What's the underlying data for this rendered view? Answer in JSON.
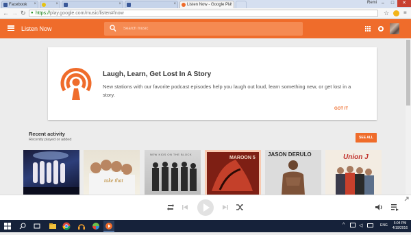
{
  "browser": {
    "tabs": [
      {
        "label": "Facebook",
        "active": false
      },
      {
        "label": "",
        "active": false
      },
      {
        "label": "",
        "active": false
      },
      {
        "label": "Listen Now - Google Pla",
        "active": true
      },
      {
        "label": "",
        "active": false
      }
    ],
    "user_label": "Remi",
    "url_secure": "https://",
    "url_host": "play.google.com",
    "url_path": "/music/listen#/now"
  },
  "app": {
    "title": "Listen Now",
    "search_placeholder": "Search music",
    "accent_color": "#ef6c2b"
  },
  "card": {
    "title": "Laugh, Learn, Get Lost In A Story",
    "body": "New stations with our favorite podcast episodes help you laugh out loud, learn something new, or get lost in a story.",
    "action": "GOT IT",
    "icon": "podcast-icon"
  },
  "recent": {
    "title": "Recent activity",
    "subtitle": "Recently played or added",
    "see_all": "SEE ALL",
    "albums": [
      {
        "name": "album-1",
        "art_text": ""
      },
      {
        "name": "album-2",
        "art_text": "take that"
      },
      {
        "name": "album-3",
        "art_text": "NEW KIDS ON THE BLOCK"
      },
      {
        "name": "album-4",
        "art_text": "MAROON 5"
      },
      {
        "name": "album-5",
        "art_text": "JASON DERULO"
      },
      {
        "name": "album-6",
        "art_text": "Union J"
      }
    ]
  },
  "player": {
    "controls": [
      "repeat-icon",
      "previous-icon",
      "play-icon",
      "next-icon",
      "shuffle-icon"
    ],
    "right_controls": [
      "volume-icon",
      "queue-icon"
    ]
  },
  "taskbar": {
    "lang": "ENG",
    "time": "5:04 PM",
    "date": "4/19/2016"
  }
}
